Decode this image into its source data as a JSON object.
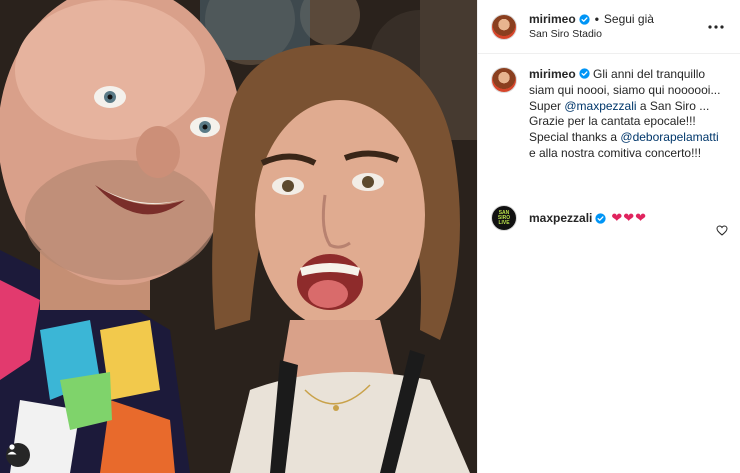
{
  "post": {
    "username": "mirimeo",
    "follow_status": "Segui già",
    "location": "San Siro Stadio",
    "more_icon": "more-horizontal-icon"
  },
  "caption": {
    "username": "mirimeo",
    "line1": "Gli anni del tranquillo siam qui noooi, siamo qui noooooi...",
    "super": "Super ",
    "mention1": "@maxpezzali",
    "after_mention1": " a San Siro ...",
    "line3": "Grazie per la cantata epocale!!!",
    "special": "Special thanks a ",
    "mention2": "@deborapelamatti",
    "after_mention2": " e alla nostra comitiva concerto!!!"
  },
  "comment": {
    "username": "maxpezzali",
    "text": "❤❤❤",
    "avatar_text": "SAN SIRO LIVE"
  },
  "colors": {
    "verified": "#0095f6",
    "link": "#00376b",
    "heart": "#e0245e",
    "border": "#efefef"
  },
  "icons": {
    "verified": "verified-badge-icon",
    "like": "heart-outline-icon",
    "user_tag": "user-tag-icon"
  }
}
